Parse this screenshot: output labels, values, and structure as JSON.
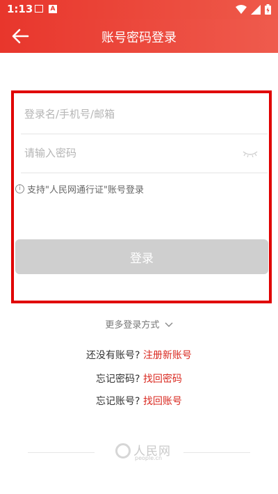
{
  "status_bar": {
    "time": "1:13"
  },
  "toolbar": {
    "title": "账号密码登录",
    "back_icon": "arrow-left-icon"
  },
  "form": {
    "username_placeholder": "登录名/手机号/邮箱",
    "password_placeholder": "请输入密码",
    "hint_text": "支持\"人民网通行证\"账号登录",
    "login_button": "登录"
  },
  "more_login": "更多登录方式",
  "links": {
    "register_prompt": "还没有账号?",
    "register_link": "注册新账号",
    "forgot_password_prompt": "忘记密码?",
    "forgot_password_link": "找回密码",
    "forgot_account_prompt": "忘记账号?",
    "forgot_account_link": "找回账号"
  },
  "footer": {
    "logo_text": "人民网",
    "logo_domain": "people.cn"
  },
  "colors": {
    "brand_red": "#e8362c",
    "link_red": "#d9281f",
    "disabled_button": "#cfcfcf"
  }
}
